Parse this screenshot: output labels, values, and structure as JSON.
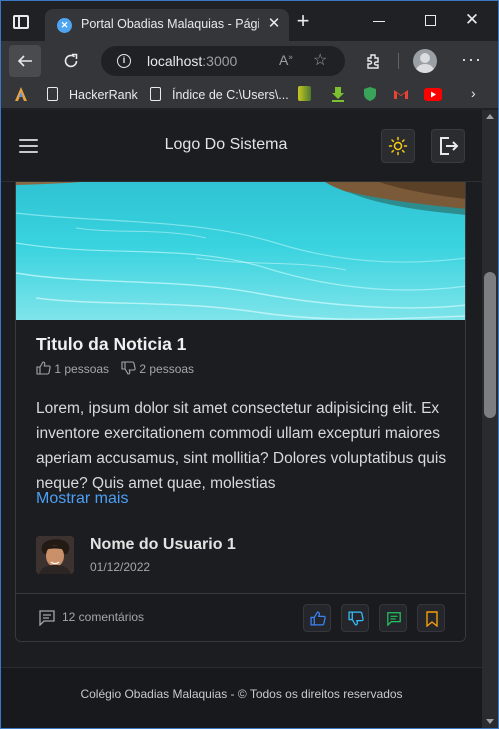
{
  "browser": {
    "tab_title": "Portal Obadias Malaquias - Págir",
    "url_host": "localhost",
    "url_port": ":3000",
    "bookmarks": [
      {
        "label": "HackerRank"
      },
      {
        "label": "Índice de C:\\Users\\..."
      }
    ]
  },
  "header": {
    "logo": "Logo Do Sistema"
  },
  "news": {
    "title": "Titulo da Noticia 1",
    "likes": "1 pessoas",
    "dislikes": "2 pessoas",
    "body": "Lorem, ipsum dolor sit amet consectetur adipisicing elit. Ex inventore exercitationem commodi ullam excepturi maiores aperiam accusamus, sint mollitia? Dolores voluptatibus quis neque? Quis amet quae, molestias",
    "more": "Mostrar mais",
    "author": "Nome do Usuario 1",
    "date": "01/12/2022",
    "comments": "12 comentários"
  },
  "footer": {
    "text": "Colégio Obadias Malaquias - © Todos os direitos reservados"
  },
  "colors": {
    "accent_blue": "#4b9ff5",
    "like_icon": "#3b82f6",
    "dislike_icon": "#38bdf8",
    "comment_icon": "#22c55e",
    "bookmark_icon": "#f59e0b",
    "theme_icon": "#facc15"
  },
  "icons": {
    "menu": "hamburger-icon",
    "theme": "sun-icon",
    "logout": "logout-icon",
    "like": "thumbs-up-icon",
    "dislike": "thumbs-down-icon",
    "comment": "comment-icon",
    "bookmark": "bookmark-icon"
  }
}
